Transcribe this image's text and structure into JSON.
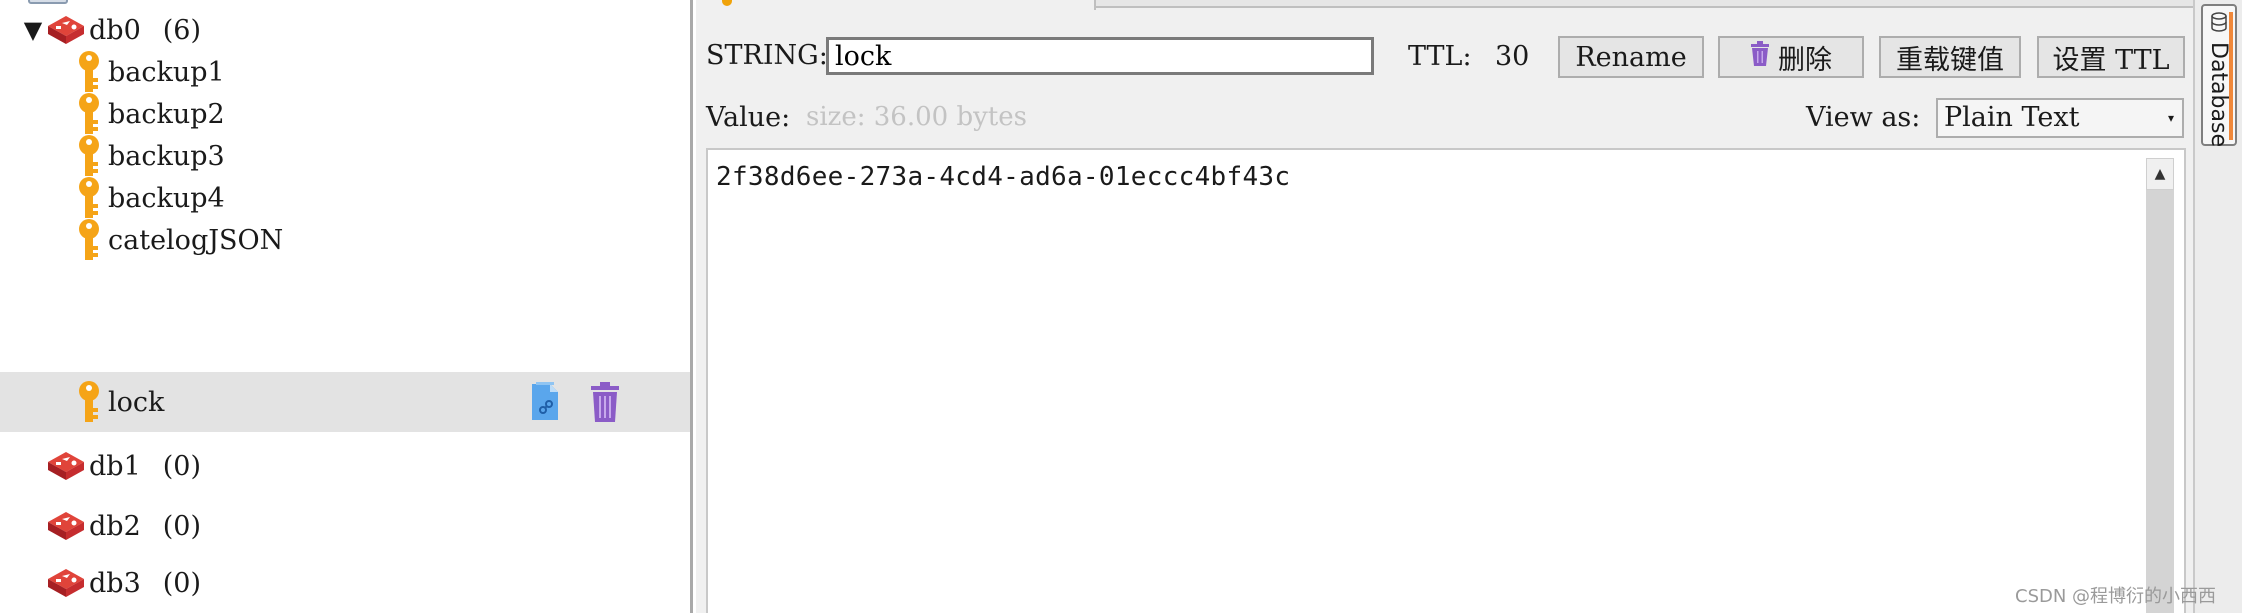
{
  "tree": {
    "databases": [
      {
        "name": "db0",
        "count": "(6)",
        "expanded": true
      },
      {
        "name": "db1",
        "count": "(0)"
      },
      {
        "name": "db2",
        "count": "(0)"
      },
      {
        "name": "db3",
        "count": "(0)"
      }
    ],
    "keys": [
      "backup1",
      "backup2",
      "backup3",
      "backup4",
      "catelogJSON",
      "lock"
    ],
    "selected_key": "lock",
    "expand_glyph": "▼",
    "icons": {
      "database": "redis-database-icon",
      "key": "key-icon",
      "copy": "copy-key-icon",
      "delete": "trash-icon"
    }
  },
  "detail": {
    "type_label": "STRING:",
    "key_value": "lock",
    "ttl_label": "TTL:",
    "ttl_value": "30",
    "buttons": {
      "rename": "Rename",
      "delete": "删除",
      "reload": "重载键值",
      "set_ttl": "设置 TTL"
    },
    "value_label": "Value:",
    "value_size": "size: 36.00 bytes",
    "view_as_label": "View as:",
    "view_as_selected": "Plain Text",
    "value_content": "2f38d6ee-273a-4cd4-ad6a-01eccc4bf43c",
    "scroll_up_glyph": "▲"
  },
  "toolstrip": {
    "database_tab": "Database"
  },
  "watermark": "CSDN @程博衍的小西西",
  "colors": {
    "key_icon": "#f5a417",
    "redis_red": "#c8292b",
    "trash": "#8b5cc7",
    "copy": "#4a90d9",
    "selected_row": "#e3e3e3",
    "accent_orange": "#f0883a"
  }
}
